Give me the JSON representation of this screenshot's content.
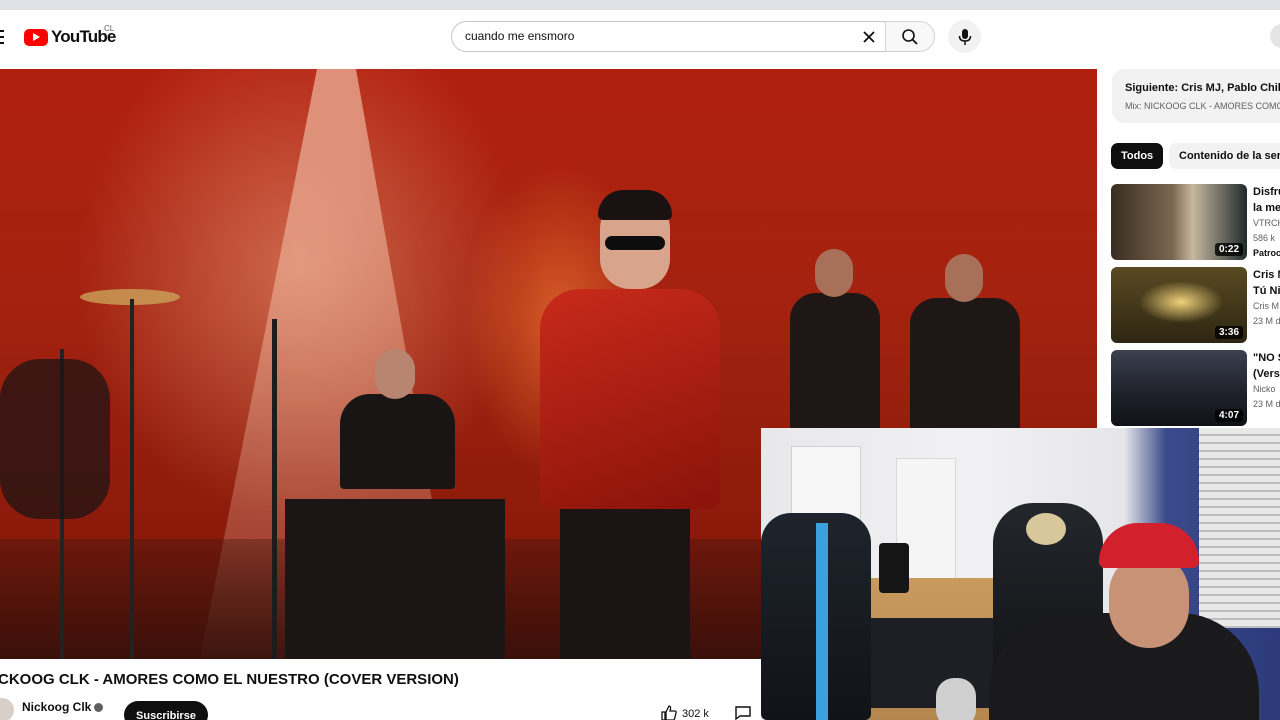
{
  "header": {
    "logo_text": "YouTube",
    "country_code": "CL",
    "search_value": "cuando me ensmoro"
  },
  "video": {
    "title": "CKOOG CLK - AMORES COMO EL NUESTRO (COVER VERSION)",
    "channel": "Nickoog Clk",
    "subscribe_label": "Suscribirse",
    "like_count": "302 k"
  },
  "sidebar": {
    "up_next_title": "Siguiente: Cris MJ, Pablo Chill-E",
    "up_next_subtitle": "Mix: NICKOOG CLK - AMORES COMO",
    "chips": [
      "Todos",
      "Contenido de la serie"
    ],
    "recommendations": [
      {
        "title": "Disfru",
        "title2": "la me",
        "meta1": "VTRCH",
        "meta2": "586 k",
        "extra": "Patroc",
        "duration": "0:22",
        "thumb_colors": [
          "#4c3b2e",
          "#8c6b4f",
          "#1e2a2a"
        ]
      },
      {
        "title": "Cris N",
        "title2": "Tú Ni",
        "meta1": "Cris M",
        "meta2": "23 M d",
        "extra": "",
        "duration": "3:36",
        "thumb_colors": [
          "#6b5a2a",
          "#caa34f",
          "#3a3418"
        ]
      },
      {
        "title": "\"NO S",
        "title2": "(Vers",
        "meta1": "Nicko",
        "meta2": "23 M d",
        "extra": "",
        "duration": "4:07",
        "thumb_colors": [
          "#2a2d38",
          "#6a6e7e",
          "#15171e"
        ]
      }
    ]
  },
  "colors": {
    "brand_red": "#ff0000",
    "text_primary": "#0f0f0f",
    "text_secondary": "#606060"
  }
}
